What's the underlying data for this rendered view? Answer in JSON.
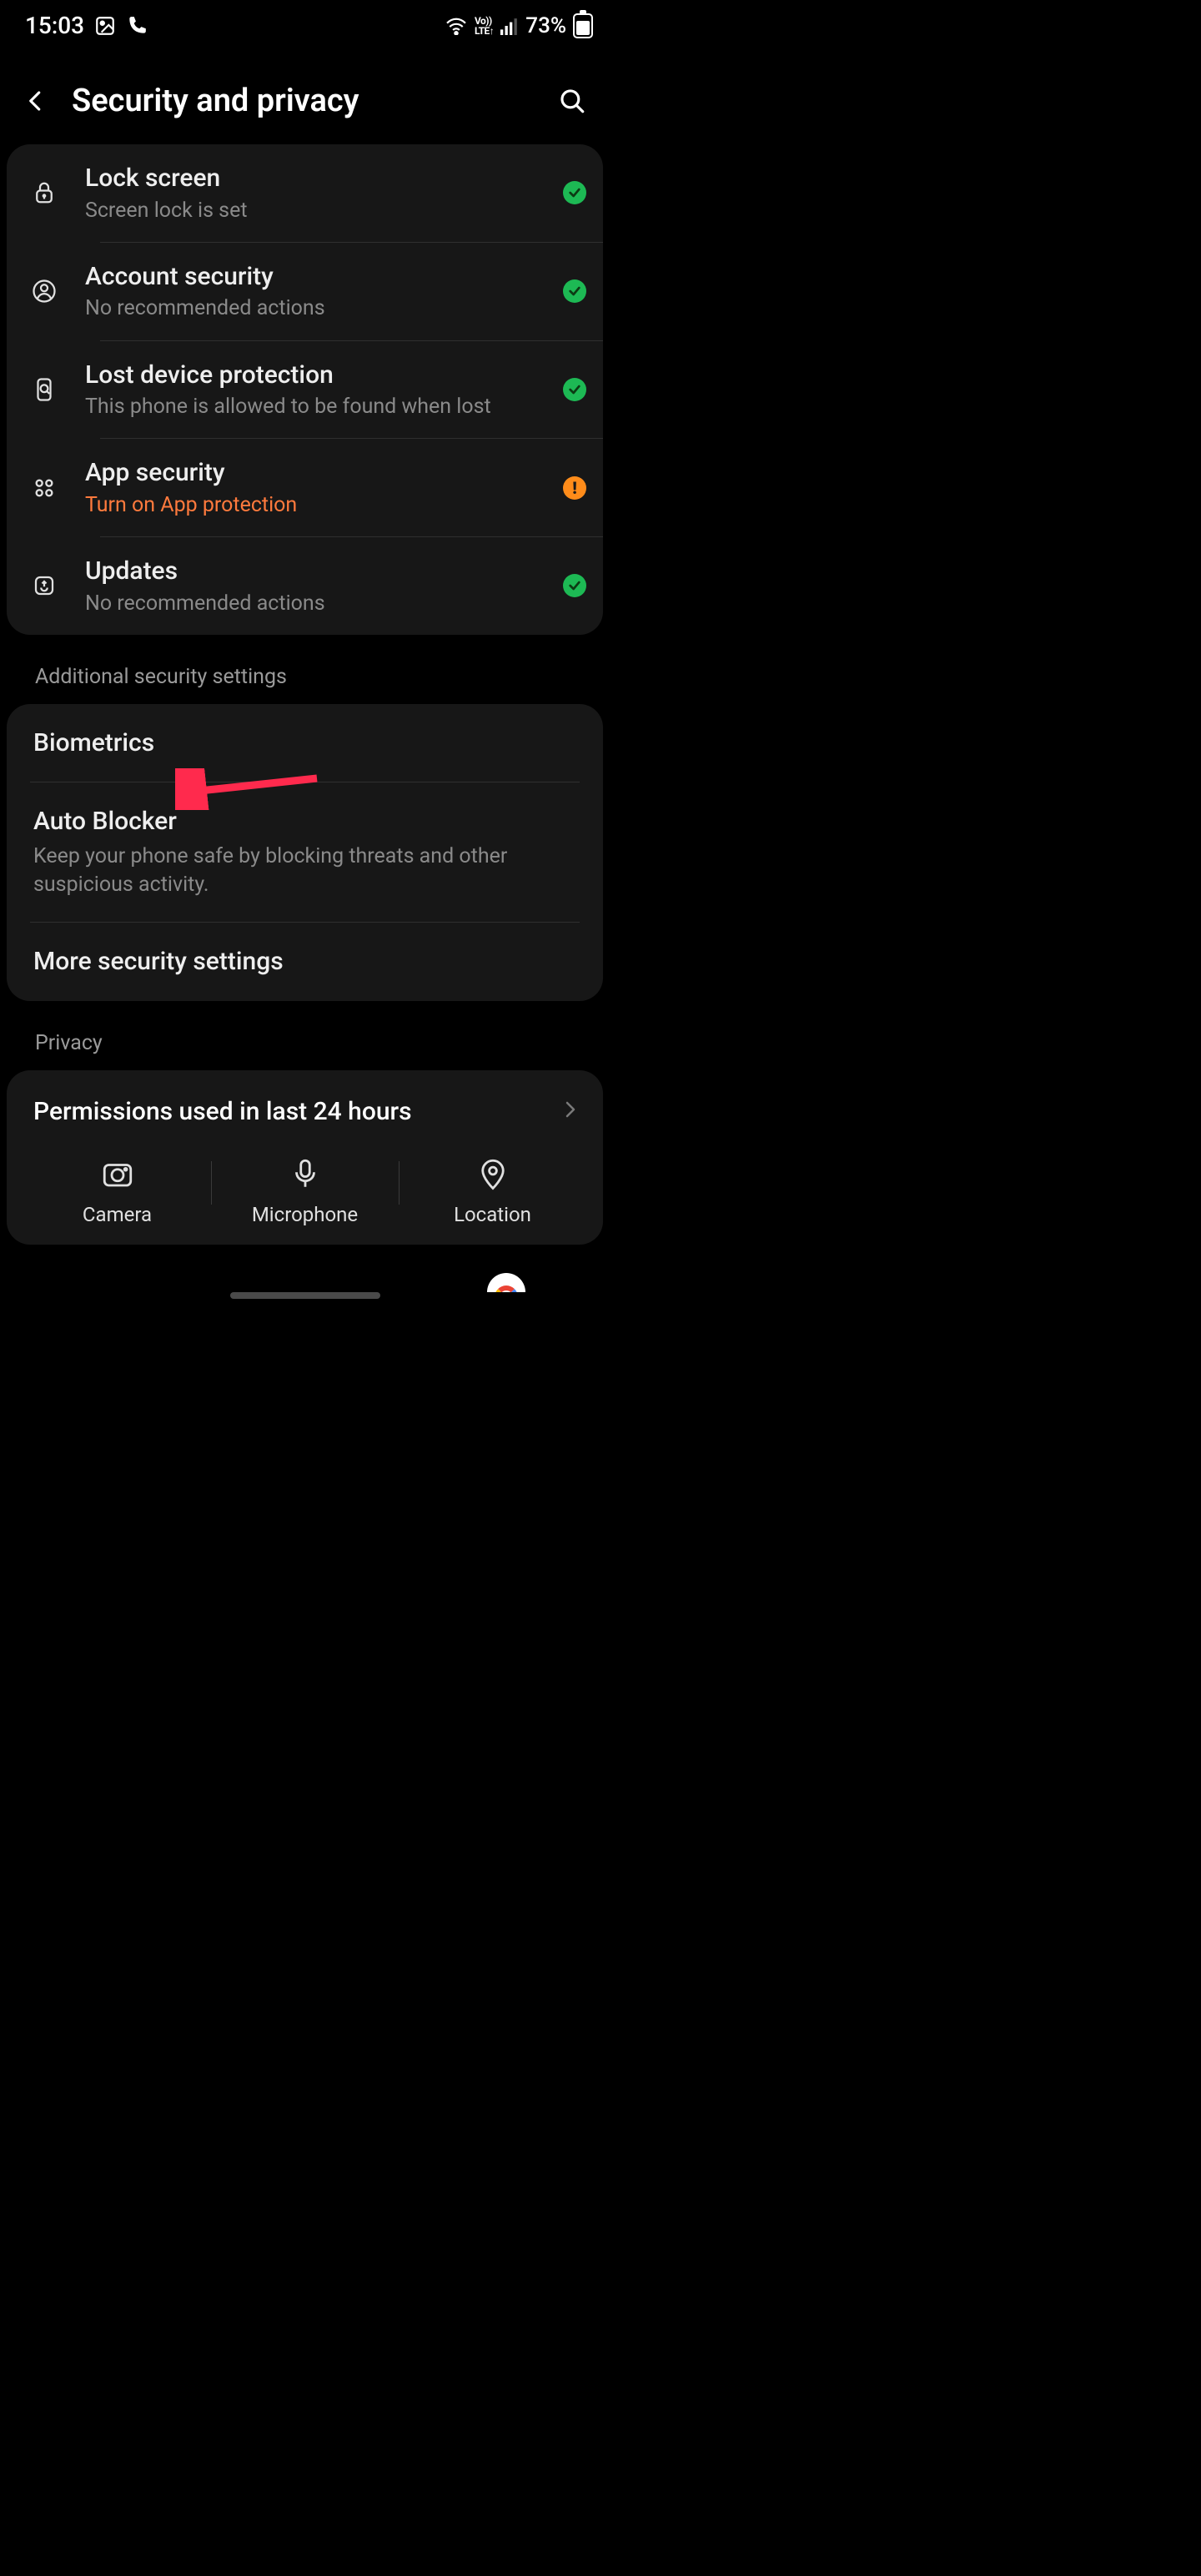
{
  "status": {
    "time": "15:03",
    "battery": "73%"
  },
  "header": {
    "title": "Security and privacy"
  },
  "dash": {
    "items": [
      {
        "title": "Lock screen",
        "sub": "Screen lock is set",
        "status": "ok"
      },
      {
        "title": "Account security",
        "sub": "No recommended actions",
        "status": "ok"
      },
      {
        "title": "Lost device protection",
        "sub": "This phone is allowed to be found when lost",
        "status": "ok"
      },
      {
        "title": "App security",
        "sub": "Turn on App protection",
        "status": "warn"
      },
      {
        "title": "Updates",
        "sub": "No recommended actions",
        "status": "ok"
      }
    ]
  },
  "sections": {
    "additional_label": "Additional security settings",
    "biometrics": "Biometrics",
    "autoblocker_title": "Auto Blocker",
    "autoblocker_sub": "Keep your phone safe by blocking threats and other suspicious activity.",
    "more": "More security settings",
    "privacy_label": "Privacy"
  },
  "permissions": {
    "title": "Permissions used in last 24 hours",
    "items": [
      {
        "label": "Camera"
      },
      {
        "label": "Microphone"
      },
      {
        "label": "Location"
      }
    ]
  }
}
